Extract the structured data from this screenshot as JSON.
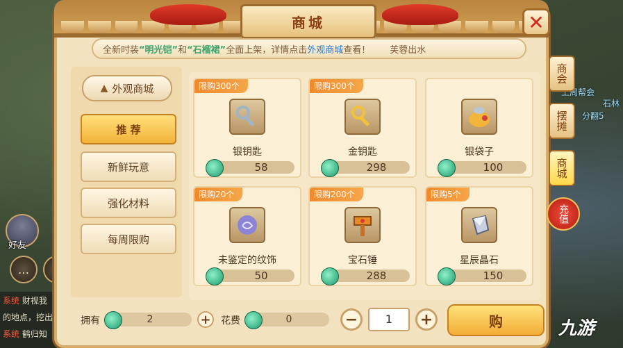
{
  "window": {
    "title": "商城",
    "close_label": "✕"
  },
  "notice": {
    "prefix": "全新时装",
    "item1": "“明光铠”",
    "and": "和",
    "item2": "“石榴裙”",
    "middle": "全面上架，详情点击",
    "link": "外观商城",
    "suffix": "查看！",
    "source": "芙蓉出水"
  },
  "nav": {
    "header": "外观商城",
    "items": [
      {
        "label": "推 荐",
        "active": true
      },
      {
        "label": "新鲜玩意",
        "active": false
      },
      {
        "label": "强化材料",
        "active": false
      },
      {
        "label": "每周限购",
        "active": false
      }
    ]
  },
  "items": [
    {
      "limit": "限购300个",
      "name": "银钥匙",
      "price": "58",
      "icon": "silver-key-icon"
    },
    {
      "limit": "限购300个",
      "name": "金钥匙",
      "price": "298",
      "icon": "gold-key-icon"
    },
    {
      "limit": "",
      "name": "银袋子",
      "price": "100",
      "icon": "silver-bag-icon"
    },
    {
      "limit": "限购20个",
      "name": "未鉴定的纹饰",
      "price": "50",
      "icon": "ornament-icon"
    },
    {
      "limit": "限购200个",
      "name": "宝石锤",
      "price": "288",
      "icon": "gem-hammer-icon"
    },
    {
      "limit": "限购5个",
      "name": "星辰晶石",
      "price": "150",
      "icon": "crystal-icon"
    }
  ],
  "bottom": {
    "own_label": "拥有",
    "own_value": "2",
    "cost_label": "花费",
    "cost_value": "0",
    "quantity": "1",
    "buy_label": "购"
  },
  "side_tabs": [
    {
      "label": "商会",
      "active": false
    },
    {
      "label": "摆摊",
      "active": false
    },
    {
      "label": "商城",
      "active": true
    }
  ],
  "recharge_label": "充值",
  "game_ui": {
    "friend_label": "好友",
    "chat_lines": [
      {
        "tag": "系统",
        "text": "财视我"
      },
      {
        "tag": "",
        "text": "的地点，挖出"
      },
      {
        "tag": "系统",
        "text": "鹤归知"
      }
    ],
    "world_names": [
      "上周帮会",
      "石林",
      "分翻5"
    ]
  },
  "watermark": "九游",
  "colors": {
    "accent": "#f2ad36",
    "limit_tag": "#f08a2c",
    "close": "#d1281b",
    "link": "#2f78c5",
    "highlight": "#3ea26b"
  }
}
